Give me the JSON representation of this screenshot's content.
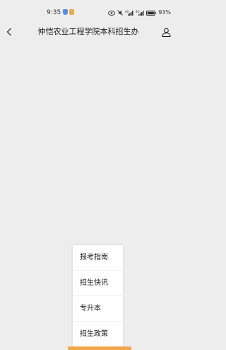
{
  "status_bar": {
    "time": "9:35",
    "battery": "93%",
    "icons": [
      "shield-app-icon",
      "gallery-app-icon",
      "eye-icon",
      "mute-icon",
      "signal-icon",
      "signal-icon",
      "battery-icon"
    ],
    "signal_labels": [
      "4G",
      "4G"
    ]
  },
  "nav": {
    "title": "仲恺农业工程学院本科招生办",
    "back_icon": "chevron-left-icon",
    "profile_icon": "person-icon"
  },
  "menu": {
    "items": [
      {
        "label": "报考指南"
      },
      {
        "label": "招生快讯"
      },
      {
        "label": "专升本"
      },
      {
        "label": "招生政策"
      }
    ]
  },
  "colors": {
    "background": "#ededed",
    "menu_background": "#ffffff",
    "accent_bar": "#f0a64c"
  }
}
